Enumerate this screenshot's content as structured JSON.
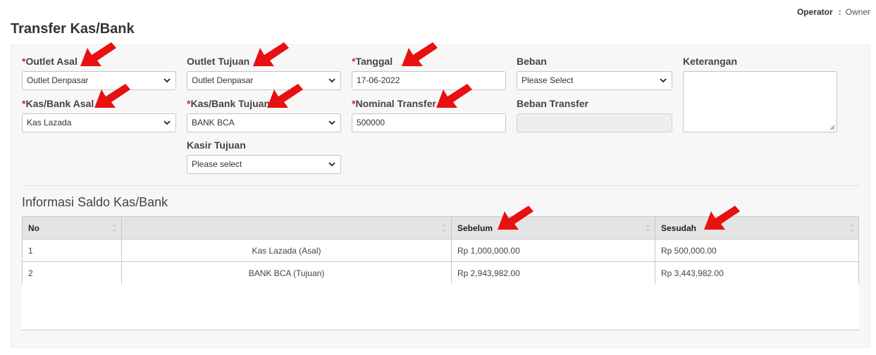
{
  "header": {
    "operator_label": "Operator",
    "operator_sep": ":",
    "operator_value": "Owner",
    "page_title": "Transfer Kas/Bank"
  },
  "form": {
    "required_mark": "*",
    "outlet_asal": {
      "label": "Outlet Asal",
      "value": "Outlet Denpasar"
    },
    "outlet_tujuan": {
      "label": "Outlet Tujuan",
      "value": "Outlet Denpasar"
    },
    "tanggal": {
      "label": "Tanggal",
      "value": "17-06-2022"
    },
    "beban": {
      "label": "Beban",
      "value": "Please Select"
    },
    "keterangan": {
      "label": "Keterangan",
      "value": ""
    },
    "kas_bank_asal": {
      "label": "Kas/Bank Asal",
      "value": "Kas Lazada"
    },
    "kas_bank_tujuan": {
      "label": "Kas/Bank Tujuan",
      "value": "BANK BCA"
    },
    "nominal_transfer": {
      "label": "Nominal Transfer",
      "value": "500000"
    },
    "beban_transfer": {
      "label": "Beban Transfer",
      "value": ""
    },
    "kasir_tujuan": {
      "label": "Kasir Tujuan",
      "value": "Please select"
    }
  },
  "saldo": {
    "title": "Informasi Saldo Kas/Bank",
    "columns": [
      "No",
      "",
      "Sebelum",
      "Sesudah"
    ],
    "rows": [
      {
        "no": "1",
        "name": "Kas Lazada (Asal)",
        "sebelum": "Rp 1,000,000.00",
        "sesudah": "Rp 500,000.00"
      },
      {
        "no": "2",
        "name": "BANK BCA (Tujuan)",
        "sebelum": "Rp 2,943,982.00",
        "sesudah": "Rp 3,443,982.00"
      }
    ]
  },
  "colors": {
    "arrow": "#e81010",
    "required": "#e02020",
    "header_bg": "#e4e4e4"
  },
  "icons": [
    "chevron-down-icon",
    "sort-icon",
    "resize-grip-icon",
    "red-arrow-annotation"
  ]
}
